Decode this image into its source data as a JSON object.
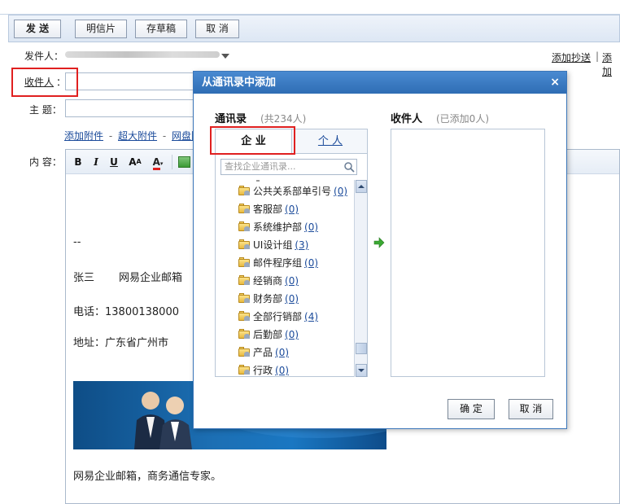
{
  "toolbar": {
    "send": "发 送",
    "postcard": "明信片",
    "save_draft": "存草稿",
    "cancel": "取 消"
  },
  "compose": {
    "sender_label": "发件人：",
    "recipient_label": "收件人",
    "recipient_colon": "：",
    "subject_label": "主  题：",
    "content_label": "内  容：",
    "add_cc": "添加抄送",
    "separator": "|",
    "add_more": "添加",
    "attach_links": {
      "add_attachment": "添加附件",
      "dash1": "-",
      "large_attachment": "超大附件",
      "dash2": "-",
      "netdisk": "网盘附"
    }
  },
  "editor": {
    "bold": "B",
    "italic": "I",
    "underline": "U",
    "font_size": "A",
    "font_color": "A"
  },
  "signature": {
    "dashes": "--",
    "name": "张三",
    "company": "网易企业邮箱",
    "phone": "电话：13800138000",
    "address": "地址：广东省广州市",
    "slogan": "网易企业邮箱，商务通信专家。"
  },
  "dialog": {
    "title": "从通讯录中添加",
    "close": "×",
    "contacts_title": "通讯录",
    "contacts_count": "(共234人)",
    "recipients_title": "收件人",
    "recipients_count": "(已添加0人)",
    "tab_enterprise": "企 业",
    "tab_personal": "个 人",
    "search_placeholder": "查找企业通讯录...",
    "confirm": "确 定",
    "cancel": "取 消",
    "groups": [
      {
        "name": "公共关系部单引号",
        "count": "(0)"
      },
      {
        "name": "客服部",
        "count": "(0)"
      },
      {
        "name": "系统维护部",
        "count": "(0)"
      },
      {
        "name": "UI设计组",
        "count": "(3)"
      },
      {
        "name": "邮件程序组",
        "count": "(0)"
      },
      {
        "name": "经销商",
        "count": "(0)"
      },
      {
        "name": "财务部",
        "count": "(0)"
      },
      {
        "name": "全部行销部",
        "count": "(4)"
      },
      {
        "name": "后勤部",
        "count": "(0)"
      },
      {
        "name": "产品",
        "count": "(0)"
      },
      {
        "name": "行政",
        "count": "(0)"
      }
    ]
  },
  "colors": {
    "accent_blue": "#2f6db4",
    "link_blue": "#1a4a9a",
    "highlight_red": "#e02020",
    "arrow_green": "#3aa832"
  }
}
